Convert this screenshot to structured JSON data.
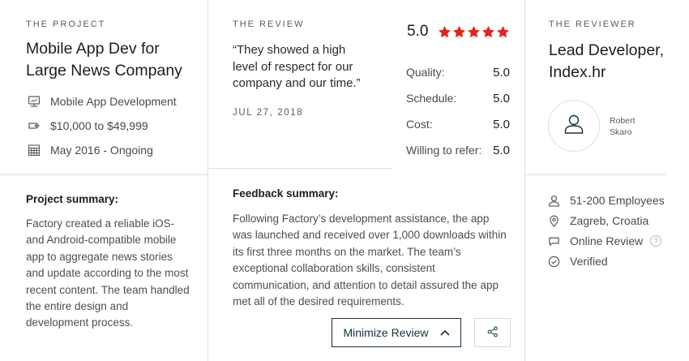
{
  "project": {
    "eyebrow": "THE PROJECT",
    "title_line1": "Mobile App Dev for",
    "title_line2": "Large News Company",
    "service": "Mobile App Development",
    "budget": "$10,000 to $49,999",
    "timeline": "May 2016 - Ongoing",
    "summary_title": "Project summary:",
    "summary_lines": [
      "Factory created a reliable iOS-",
      "and Android-compatible mobile",
      "app to aggregate news stories",
      "and update according to the most",
      "recent content. The team handled",
      "the entire design and",
      "development process."
    ]
  },
  "review": {
    "eyebrow": "THE REVIEW",
    "quote_lines": [
      "“They showed a high",
      "level of respect for our",
      "company and our time.”"
    ],
    "date": "JUL 27, 2018",
    "feedback_title": "Feedback summary:",
    "feedback_lines": [
      "Following Factory’s development assistance, the app",
      "was launched and received over 1,000 downloads within",
      "its first three months on the market. The team’s",
      "exceptional collaboration skills, consistent",
      "communication, and attention to detail assured the app",
      "met all of the desired requirements."
    ],
    "minimize_label": "Minimize Review"
  },
  "ratings": {
    "overall": "5.0",
    "stars": 5,
    "star_color": "#e62415",
    "rows": [
      {
        "label": "Quality:",
        "value": "5.0"
      },
      {
        "label": "Schedule:",
        "value": "5.0"
      },
      {
        "label": "Cost:",
        "value": "5.0"
      },
      {
        "label": "Willing to refer:",
        "value": "5.0"
      }
    ]
  },
  "reviewer": {
    "eyebrow": "THE REVIEWER",
    "title_line1": "Lead Developer,",
    "title_line2": "Index.hr",
    "name_line1": "Robert",
    "name_line2": "Skaro",
    "employees": "51-200 Employees",
    "location": "Zagreb, Croatia",
    "review_type": "Online Review",
    "help_glyph": "?",
    "verified": "Verified"
  },
  "icons": {
    "service": "mobile-device-icon",
    "budget": "price-tag-icon",
    "timeline": "calendar-icon",
    "avatar": "user-icon",
    "employees": "user-icon",
    "location": "map-pin-icon",
    "review_type": "chat-bubble-icon",
    "verified": "check-circle-icon",
    "minimize": "chevron-up-icon",
    "share": "share-icon"
  }
}
